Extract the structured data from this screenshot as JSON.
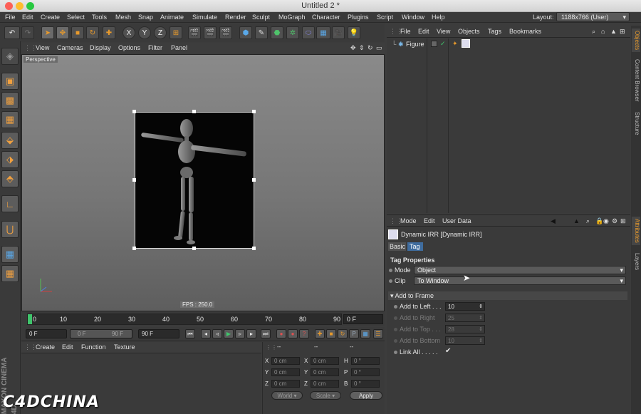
{
  "window": {
    "title": "Untitled 2 *"
  },
  "menubar": {
    "items": [
      "File",
      "Edit",
      "Create",
      "Select",
      "Tools",
      "Mesh",
      "Snap",
      "Animate",
      "Simulate",
      "Render",
      "Sculpt",
      "MoGraph",
      "Character",
      "Plugins",
      "Script",
      "Window",
      "Help"
    ],
    "layout_label": "Layout:",
    "layout_value": "1188x766 (User)"
  },
  "toolbar": {
    "undo_icon": "undo-icon",
    "axis_x": "X",
    "axis_y": "Y",
    "axis_z": "Z"
  },
  "viewport": {
    "menu": [
      "View",
      "Cameras",
      "Display",
      "Options",
      "Filter",
      "Panel"
    ],
    "label": "Perspective",
    "fps": "FPS : 250.0"
  },
  "timeline": {
    "ticks": [
      "0",
      "10",
      "20",
      "30",
      "40",
      "50",
      "60",
      "70",
      "80",
      "90"
    ],
    "end_frame": "0 F",
    "start_field": "0 F",
    "min_field": "0 F",
    "max_field": "90 F",
    "end_field": "90 F"
  },
  "material_manager": {
    "menu": [
      "Create",
      "Edit",
      "Function",
      "Texture"
    ]
  },
  "coordinates": {
    "col_headers": [
      "--",
      "--",
      "--"
    ],
    "rows": [
      {
        "a": "X",
        "av": "0 cm",
        "b": "X",
        "bv": "0 cm",
        "c": "H",
        "cv": "0 °"
      },
      {
        "a": "Y",
        "av": "0 cm",
        "b": "Y",
        "bv": "0 cm",
        "c": "P",
        "cv": "0 °"
      },
      {
        "a": "Z",
        "av": "0 cm",
        "b": "Z",
        "bv": "0 cm",
        "c": "B",
        "cv": "0 °"
      }
    ],
    "world": "World",
    "scale": "Scale",
    "apply": "Apply"
  },
  "object_manager": {
    "menu": [
      "File",
      "Edit",
      "View",
      "Objects",
      "Tags",
      "Bookmarks"
    ],
    "objects": [
      {
        "name": "Figure"
      }
    ]
  },
  "right_tabs": [
    "Objects",
    "Content Browser",
    "Structure",
    "Attributes",
    "Layers"
  ],
  "attributes": {
    "menu": [
      "Mode",
      "Edit",
      "User Data"
    ],
    "tag_title": "Dynamic IRR [Dynamic IRR]",
    "tabs": [
      "Basic",
      "Tag"
    ],
    "section_tag_properties": "Tag Properties",
    "mode_label": "Mode",
    "mode_value": "Object",
    "clip_label": "Clip",
    "clip_value": "To Window",
    "section_add_to_frame": "Add to Frame",
    "fields": [
      {
        "label": "Add to Left . . .",
        "value": "10"
      },
      {
        "label": "Add to Right",
        "value": "25"
      },
      {
        "label": "Add to Top . . .",
        "value": "28"
      },
      {
        "label": "Add to Bottom",
        "value": "10"
      }
    ],
    "link_all_label": "Link All . . . . .",
    "link_all_check": "✔"
  },
  "branding": {
    "watermark": "C4DCHINA",
    "maxon": "MAXON CINEMA 4D"
  },
  "colors": {
    "accent_orange": "#e89a2c",
    "timeline_marker": "#3fc46b",
    "tag_tab": "#3f6c9e"
  }
}
